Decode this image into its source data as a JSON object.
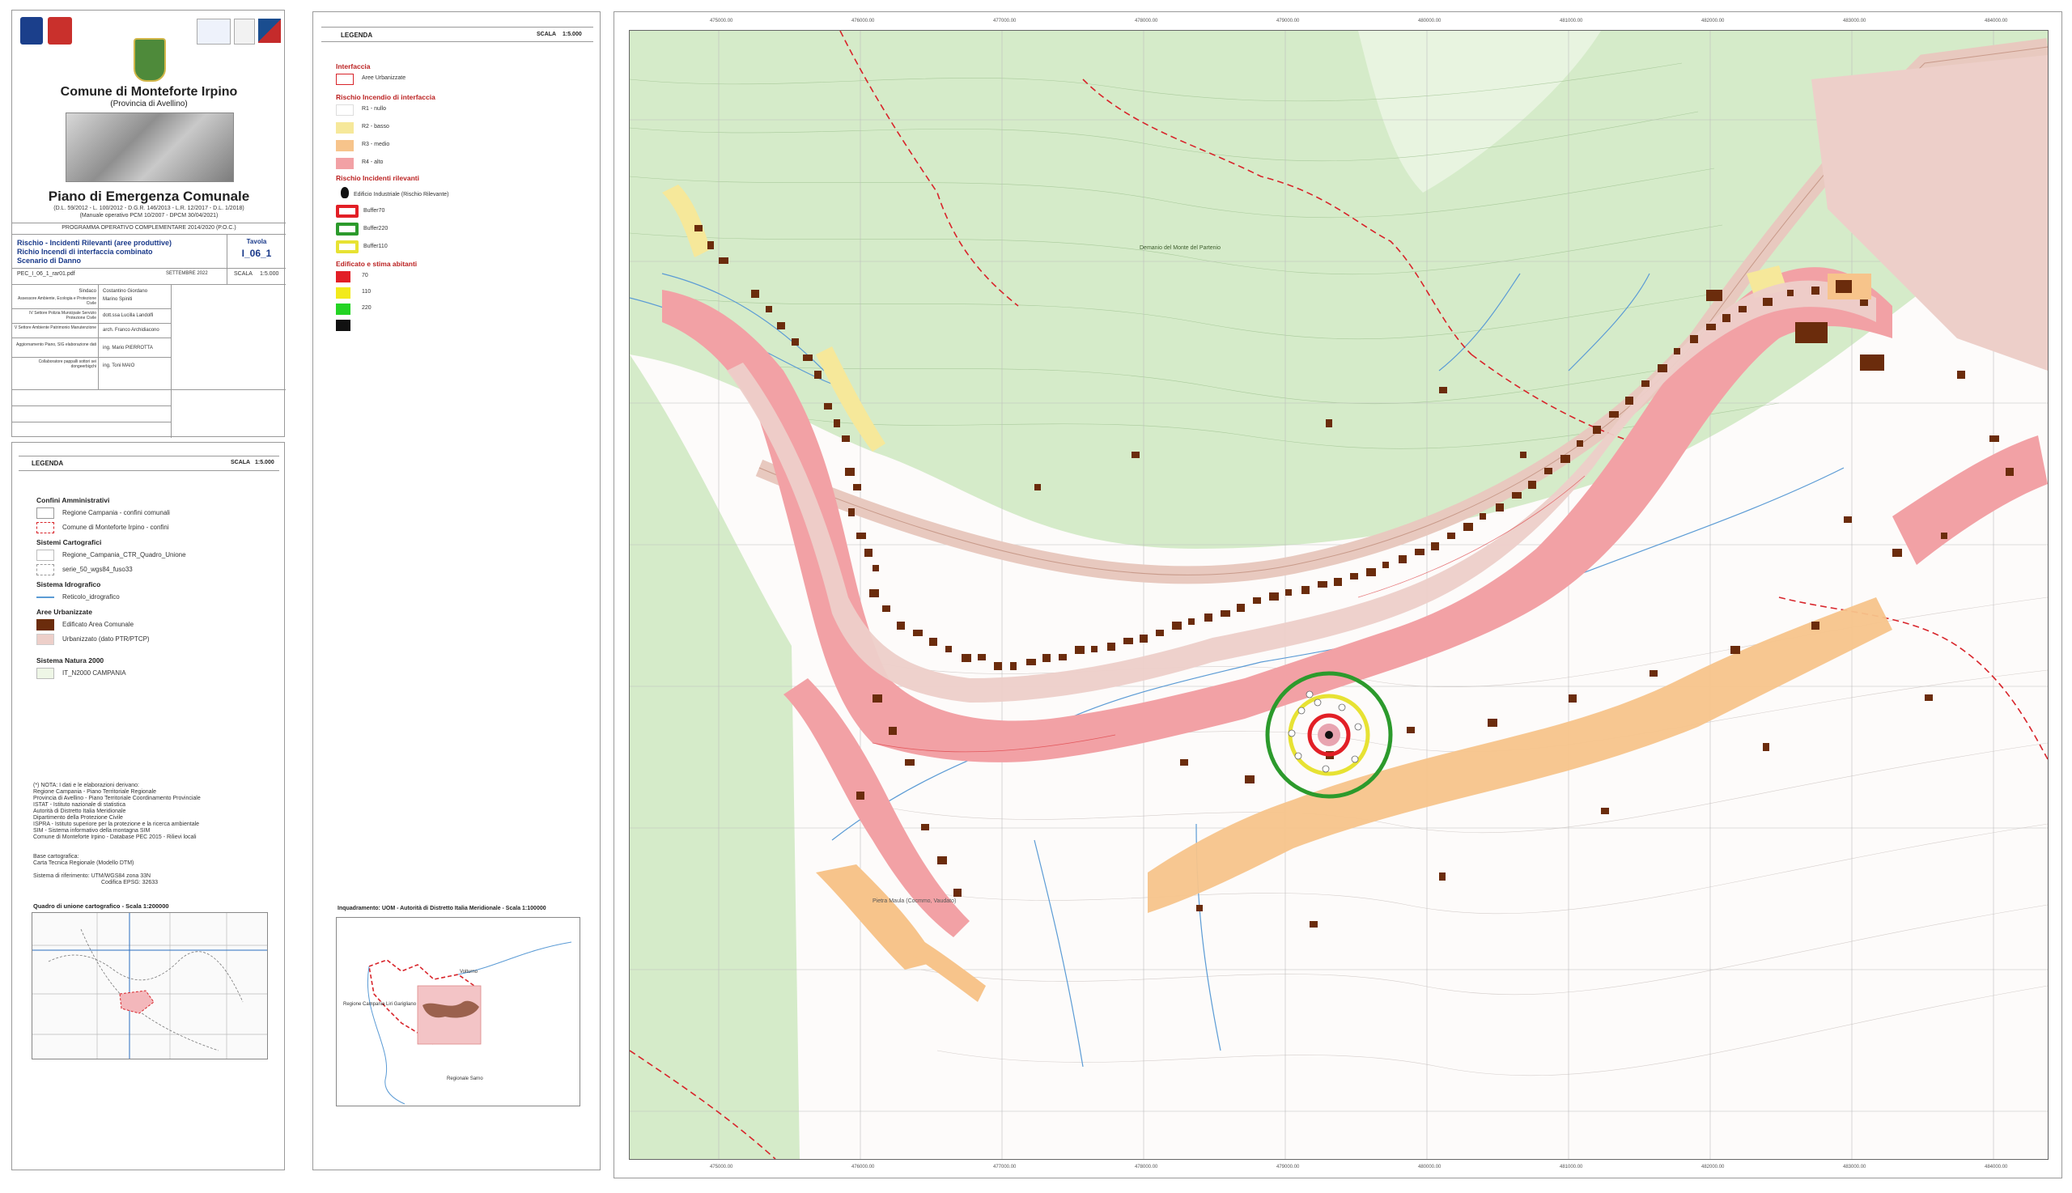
{
  "cartiglio": {
    "comune": "Comune di Monteforte Irpino",
    "provincia": "(Provincia di Avellino)",
    "piano": "Piano di Emergenza Comunale",
    "norme": "(D.L. 59/2012 - L. 100/2012 - D.G.R. 146/2013 - L.R. 12/2017 - D.L. 1/2018)",
    "manuale": "(Manuale operativo PCM 10/2007 - DPCM 30/04/2021)",
    "programma": "PROGRAMMA OPERATIVO COMPLEMENTARE 2014/2020 (P.O.C.)",
    "titolo1": "Rischio - Incidenti Rilevanti (aree produttive)",
    "titolo2": "Richio Incendi di interfaccia combinato",
    "titolo3": "Scenario di Danno",
    "tavola_label": "Tavola",
    "tavola_num": "I_06_1",
    "file": "PEC_I_06_1_rar01.pdf",
    "data": "SETTEMBRE 2022",
    "scala_label": "SCALA",
    "scala": "1:5.000",
    "staff": [
      {
        "ruolo": "Sindaco",
        "nome": "Costantino Giordano"
      },
      {
        "ruolo": "Assessore Ambiente, Ecologia e Protezione Civile",
        "nome": "Marino Spiniti"
      },
      {
        "ruolo": "IV Settore Polizia Municipale Servizio Protezione Civile",
        "nome": "dott.ssa Lucilla Landolfi"
      },
      {
        "ruolo": "V Settore Ambiente Patrimonio Manutenzione",
        "nome": "arch. Franco Archidiacono"
      },
      {
        "ruolo": "Aggiornamento Piano, SIG elaborazione dati",
        "nome": "ing. Mario PIERROTTA"
      },
      {
        "ruolo": "Collaboratore pappalli sottori sei dongeerbigchi",
        "nome": "ing. Toni MAIO"
      }
    ]
  },
  "legenda1": {
    "title": "LEGENDA",
    "scala_label": "SCALA",
    "scala": "1:5.000",
    "sections": {
      "confini": "Confini Amministrativi",
      "confini_1": "Regione Campania - confini comunali",
      "confini_2": "Comune di Monteforte Irpino - confini",
      "sistemi": "Sistemi Cartografici",
      "sistemi_1": "Regione_Campania_CTR_Quadro_Unione",
      "sistemi_2": "serie_50_wgs84_fuso33",
      "idro": "Sistema Idrografico",
      "idro_1": "Reticolo_idrografico",
      "aree": "Aree Urbanizzate",
      "aree_1": "Edificato Area Comunale",
      "aree_2": "Urbanizzato (dato PTR/PTCP)",
      "natura": "Sistema Natura 2000",
      "natura_1": "IT_N2000 CAMPANIA"
    },
    "note": [
      "(*) NOTA: I dati e le elaborazioni derivano:",
      "Regione Campania - Piano Territoriale Regionale",
      "Provincia di Avellino - Piano Territoriale Coordinamento Provinciale",
      "ISTAT - Istituto nazionale di statistica",
      "Autorità di Distretto Italia Meridionale",
      "Dipartimento della Protezione Civile",
      "ISPRA - Istituto superiore per la protezione e la ricerca ambientale",
      "SIM - Sistema informativo della montagna SIM",
      "Comune di Monteforte Irpino - Database PEC 2015 - Rilievi locali"
    ],
    "base1": "Base cartografica:",
    "base2": "Carta Tecnica Regionale (Modello DTM)",
    "rif1": "Sistema di riferimento: UTM/WGS84 zona 33N",
    "rif2": "Codifica EPSG: 32633",
    "quadro": "Quadro di unione cartografico - Scala 1:200000"
  },
  "legenda2": {
    "title": "LEGENDA",
    "scala_label": "SCALA",
    "scala": "1:5.000",
    "interfaccia": "Interfaccia",
    "aree_urb": "Aree Urbanizzate",
    "rischio_head": "Rischio Incendio di interfaccia",
    "r1": "R1 - nullo",
    "r2": "R2 - basso",
    "r3": "R3 - medio",
    "r4": "R4 - alto",
    "ril_head": "Rischio Incidenti rilevanti",
    "edificio": "Edificio Industriale (Rischio Rilevante)",
    "buffer70": "Buffer70",
    "buffer220": "Buffer220",
    "buffer110": "Buffer110",
    "stima_head": "Edificato e stima abitanti",
    "s70": "70",
    "s110": "110",
    "s220": "220",
    "inquadramento": "Inquadramento: UOM - Autorità di Distretto Italia Meridionale - Scala 1:100000",
    "inq_lab1": "Regione Campania",
    "inq_lab2": "Volturno",
    "inq_lab3": "Regionale Sarno",
    "inq_lab4": "Regione Campania Liri Garigliano"
  },
  "map": {
    "grid_top": [
      "475000.00",
      "476000.00",
      "477000.00",
      "478000.00",
      "479000.00",
      "480000.00",
      "481000.00",
      "482000.00",
      "483000.00",
      "484000.00"
    ],
    "label_monte": "Demanio del Monte del Partenio",
    "label_pietra": "Pietra Maula (Cocmmo, Vaudato)",
    "colors": {
      "r4": "#f2a1a5",
      "r3": "#f7c48b",
      "r2": "#f6e89a",
      "building": "#6b2c0c",
      "urban": "#edcfc9",
      "forest": "#d5ebc9",
      "boundary": "#d8242a"
    }
  }
}
